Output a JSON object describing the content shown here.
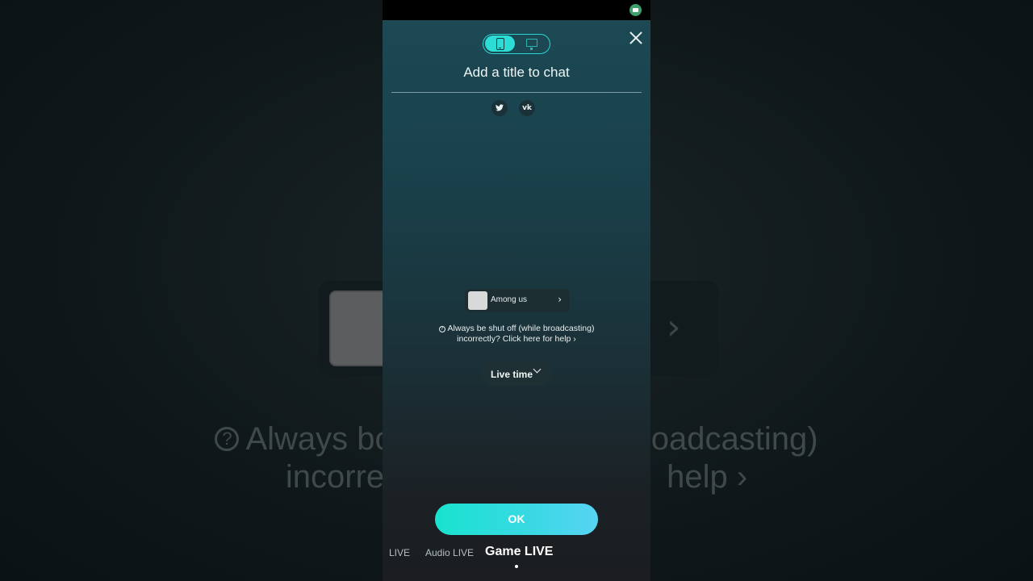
{
  "background": {
    "help_line1": "Always bo",
    "help_line1_right": "oadcasting)",
    "help_line2": "incorre",
    "help_line2_right": "help ›",
    "chevron": "›"
  },
  "header": {
    "mode_toggle": [
      "phone-icon",
      "monitor-icon"
    ],
    "title": "Add a title to chat",
    "close_icon": "close-icon"
  },
  "share": {
    "twitter": "🐦",
    "vk": "vk"
  },
  "game": {
    "name": "Among us",
    "chevron": "›"
  },
  "help": {
    "line1": "Always be shut off (while broadcasting)",
    "line2": "incorrectly? Click here for help ›"
  },
  "live_time": {
    "label": "Live time"
  },
  "ok_label": "OK",
  "mode_tabs": [
    "LIVE",
    "Audio LIVE",
    "Game LIVE"
  ],
  "colors": {
    "accent": "#2bddd4",
    "ok_start": "#19e3cf",
    "ok_end": "#58d4f5"
  }
}
